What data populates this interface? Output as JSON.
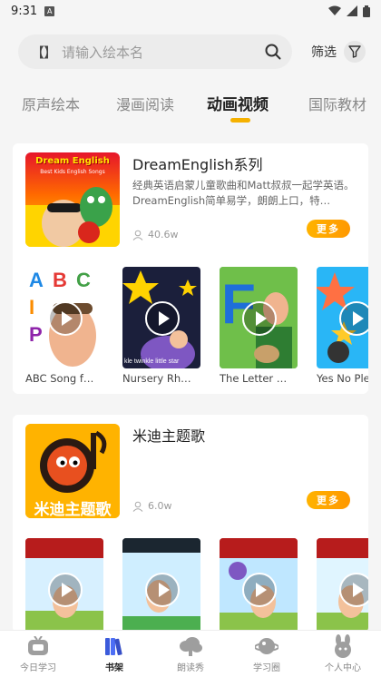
{
  "status_bar": {
    "time": "9:31",
    "a_badge": "A"
  },
  "search": {
    "bracket": "【】",
    "placeholder": "请输入绘本名",
    "filter_label": "筛选"
  },
  "tabs": [
    {
      "label": "原声绘本",
      "active": false
    },
    {
      "label": "漫画阅读",
      "active": false
    },
    {
      "label": "动画视频",
      "active": true
    },
    {
      "label": "国际教材",
      "active": false
    }
  ],
  "accent_color": "#f5b100",
  "series": [
    {
      "title": "DreamEnglish系列",
      "description": "经典英语启蒙儿童歌曲和Matt叔叔一起学英语。DreamEnglish简单易学，朗朗上口，特…",
      "views": "40.6w",
      "more_label": "更多",
      "cover_text_line1": "Dream English",
      "cover_text_line2": "Best Kids English Songs",
      "videos": [
        {
          "label": "ABC Song f…"
        },
        {
          "label": "Nursery Rh…"
        },
        {
          "label": "The Letter …"
        },
        {
          "label": "Yes No Ple…"
        }
      ]
    },
    {
      "title": "米迪主题歌",
      "description": "",
      "views": "6.0w",
      "more_label": "更多",
      "cover_text": "米迪主题歌",
      "videos": [
        {
          "label": ""
        },
        {
          "label": ""
        },
        {
          "label": ""
        },
        {
          "label": ""
        }
      ]
    }
  ],
  "bottom_nav": [
    {
      "label": "今日学习",
      "icon": "tv-icon",
      "active": false
    },
    {
      "label": "书架",
      "icon": "books-icon",
      "active": true
    },
    {
      "label": "朗读秀",
      "icon": "cloud-icon",
      "active": false
    },
    {
      "label": "学习圈",
      "icon": "planet-icon",
      "active": false
    },
    {
      "label": "个人中心",
      "icon": "bunny-icon",
      "active": false
    }
  ]
}
